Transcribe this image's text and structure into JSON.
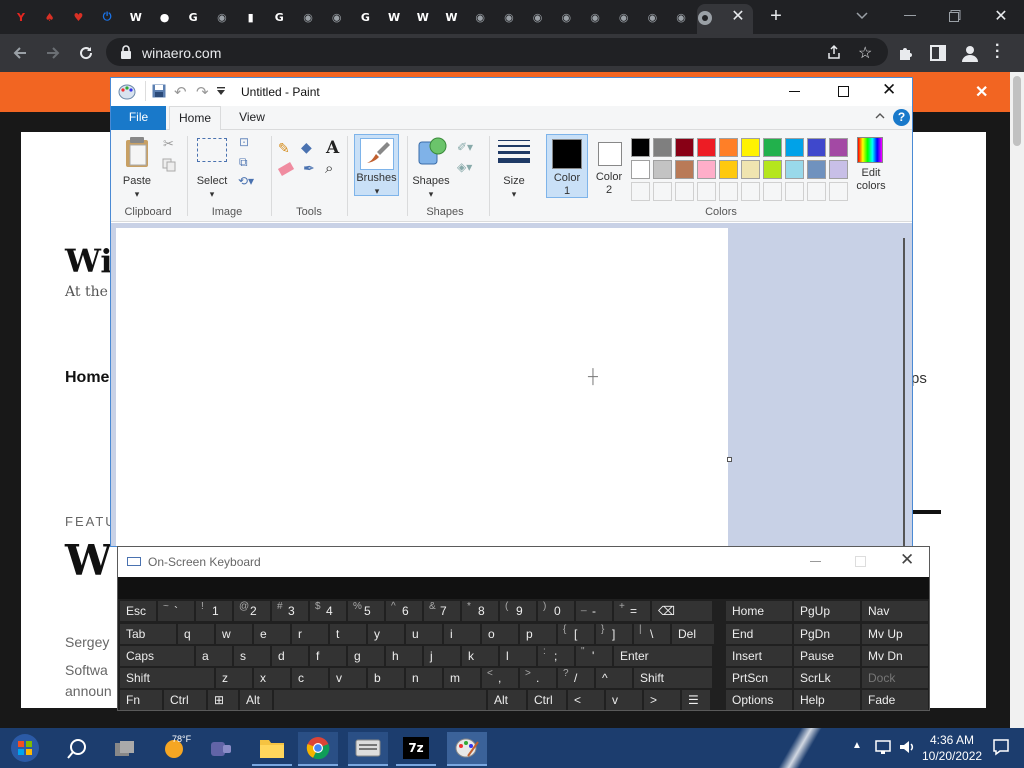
{
  "browser": {
    "tabs": [
      {
        "icon": "yandex-icon",
        "glyph": "Y",
        "color": "#e52620"
      },
      {
        "icon": "cards-icon",
        "glyph": "♠",
        "color": "#d93025"
      },
      {
        "icon": "cards-icon",
        "glyph": "♥",
        "color": "#d93025"
      },
      {
        "icon": "power-icon",
        "glyph": "⏻",
        "color": "#1a73e8"
      },
      {
        "icon": "wikipedia-icon",
        "glyph": "W",
        "color": "#ffffff"
      },
      {
        "icon": "github-icon",
        "glyph": "●",
        "color": "#ffffff"
      },
      {
        "icon": "google-icon",
        "glyph": "G",
        "color": "#ffffff"
      },
      {
        "icon": "chrome-icon",
        "glyph": "◉",
        "color": "#9aa0a6"
      },
      {
        "icon": "document-icon",
        "glyph": "▮",
        "color": "#ffffff"
      },
      {
        "icon": "google-icon",
        "glyph": "G",
        "color": "#ffffff"
      },
      {
        "icon": "chrome-icon",
        "glyph": "◉",
        "color": "#9aa0a6"
      },
      {
        "icon": "chrome-icon",
        "glyph": "◉",
        "color": "#9aa0a6"
      },
      {
        "icon": "google-icon",
        "glyph": "G",
        "color": "#ffffff"
      },
      {
        "icon": "wikipedia-icon",
        "glyph": "W",
        "color": "#ffffff"
      },
      {
        "icon": "wikipedia-icon",
        "glyph": "W",
        "color": "#ffffff"
      },
      {
        "icon": "wikipedia-icon",
        "glyph": "W",
        "color": "#ffffff"
      },
      {
        "icon": "chrome-icon",
        "glyph": "◉",
        "color": "#9aa0a6"
      },
      {
        "icon": "chrome-icon",
        "glyph": "◉",
        "color": "#9aa0a6"
      },
      {
        "icon": "chrome-icon",
        "glyph": "◉",
        "color": "#9aa0a6"
      },
      {
        "icon": "chrome-icon",
        "glyph": "◉",
        "color": "#9aa0a6"
      },
      {
        "icon": "chrome-icon",
        "glyph": "◉",
        "color": "#9aa0a6"
      },
      {
        "icon": "chrome-icon",
        "glyph": "◉",
        "color": "#9aa0a6"
      },
      {
        "icon": "chrome-icon",
        "glyph": "◉",
        "color": "#9aa0a6"
      },
      {
        "icon": "chrome-icon",
        "glyph": "◉",
        "color": "#9aa0a6"
      },
      {
        "icon": "chrome-icon",
        "glyph": "◉",
        "color": "#9aa0a6"
      }
    ],
    "url": "winaero.com",
    "accent": "#f26522"
  },
  "website": {
    "title": "Wi",
    "tagline": "At the e",
    "nav_home": "Home",
    "nav_right": "ps",
    "featured": "FEATU",
    "big_heading": "W",
    "author": "Sergey",
    "excerpt_1": "Softwa",
    "excerpt_2": "announ"
  },
  "paint": {
    "title": "Untitled - Paint",
    "tabs": [
      "File",
      "Home",
      "View"
    ],
    "groups": {
      "clipboard": "Clipboard",
      "image": "Image",
      "tools": "Tools",
      "shapes": "Shapes",
      "colors": "Colors"
    },
    "buttons": {
      "paste": "Paste",
      "select": "Select",
      "brushes": "Brushes",
      "shapes": "Shapes",
      "size": "Size",
      "color1_a": "Color",
      "color1_b": "1",
      "color2_a": "Color",
      "color2_b": "2",
      "edit_a": "Edit",
      "edit_b": "colors"
    },
    "color1": "#000000",
    "color2": "#ffffff",
    "palette_row1": [
      "#000000",
      "#7f7f7f",
      "#880015",
      "#ed1c24",
      "#ff7f27",
      "#fff200",
      "#22b14c",
      "#00a2e8",
      "#3f48cc",
      "#a349a4"
    ],
    "palette_row2": [
      "#ffffff",
      "#c3c3c3",
      "#b97a57",
      "#ffaec9",
      "#ffc90e",
      "#efe4b0",
      "#b5e61d",
      "#99d9ea",
      "#7092be",
      "#c8bfe7"
    ]
  },
  "osk": {
    "title": "On-Screen Keyboard",
    "rows": [
      [
        [
          "Esc",
          ""
        ],
        [
          "`",
          "~"
        ],
        [
          "1",
          "!"
        ],
        [
          "2",
          "@"
        ],
        [
          "3",
          "#"
        ],
        [
          "4",
          "$"
        ],
        [
          "5",
          "%"
        ],
        [
          "6",
          "^"
        ],
        [
          "7",
          "&"
        ],
        [
          "8",
          "*"
        ],
        [
          "9",
          "("
        ],
        [
          "0",
          ")"
        ],
        [
          "-",
          "_"
        ],
        [
          "=",
          "+"
        ],
        [
          "⌫",
          ""
        ]
      ],
      [
        [
          "Tab",
          ""
        ],
        [
          "q",
          ""
        ],
        [
          "w",
          ""
        ],
        [
          "e",
          ""
        ],
        [
          "r",
          ""
        ],
        [
          "t",
          ""
        ],
        [
          "y",
          ""
        ],
        [
          "u",
          ""
        ],
        [
          "i",
          ""
        ],
        [
          "o",
          ""
        ],
        [
          "p",
          ""
        ],
        [
          "[",
          "{"
        ],
        [
          "]",
          "}"
        ],
        [
          "\\",
          "|"
        ],
        [
          "Del",
          ""
        ]
      ],
      [
        [
          "Caps",
          ""
        ],
        [
          "a",
          ""
        ],
        [
          "s",
          ""
        ],
        [
          "d",
          ""
        ],
        [
          "f",
          ""
        ],
        [
          "g",
          ""
        ],
        [
          "h",
          ""
        ],
        [
          "j",
          ""
        ],
        [
          "k",
          ""
        ],
        [
          "l",
          ""
        ],
        [
          ";",
          ":"
        ],
        [
          "'",
          "\""
        ],
        [
          "Enter",
          ""
        ]
      ],
      [
        [
          "Shift",
          ""
        ],
        [
          "z",
          ""
        ],
        [
          "x",
          ""
        ],
        [
          "c",
          ""
        ],
        [
          "v",
          ""
        ],
        [
          "b",
          ""
        ],
        [
          "n",
          ""
        ],
        [
          "m",
          ""
        ],
        [
          ",",
          "<"
        ],
        [
          ".",
          ">"
        ],
        [
          "/",
          "?"
        ],
        [
          "^",
          ""
        ],
        [
          "Shift",
          ""
        ]
      ],
      [
        [
          "Fn",
          ""
        ],
        [
          "Ctrl",
          ""
        ],
        [
          "⊞",
          ""
        ],
        [
          "Alt",
          ""
        ],
        [
          "",
          ""
        ],
        [
          "Alt",
          ""
        ],
        [
          "Ctrl",
          ""
        ],
        [
          "<",
          ""
        ],
        [
          "v",
          ""
        ],
        [
          ">",
          ""
        ],
        [
          "☰",
          ""
        ]
      ]
    ],
    "nav": [
      [
        "Home",
        "PgUp",
        "Nav"
      ],
      [
        "End",
        "PgDn",
        "Mv Up"
      ],
      [
        "Insert",
        "Pause",
        "Mv Dn"
      ],
      [
        "PrtScn",
        "ScrLk",
        "Dock"
      ],
      [
        "Options",
        "Help",
        "Fade"
      ]
    ]
  },
  "taskbar": {
    "weather": "78°F",
    "time": "4:36 AM",
    "date": "10/20/2022"
  }
}
